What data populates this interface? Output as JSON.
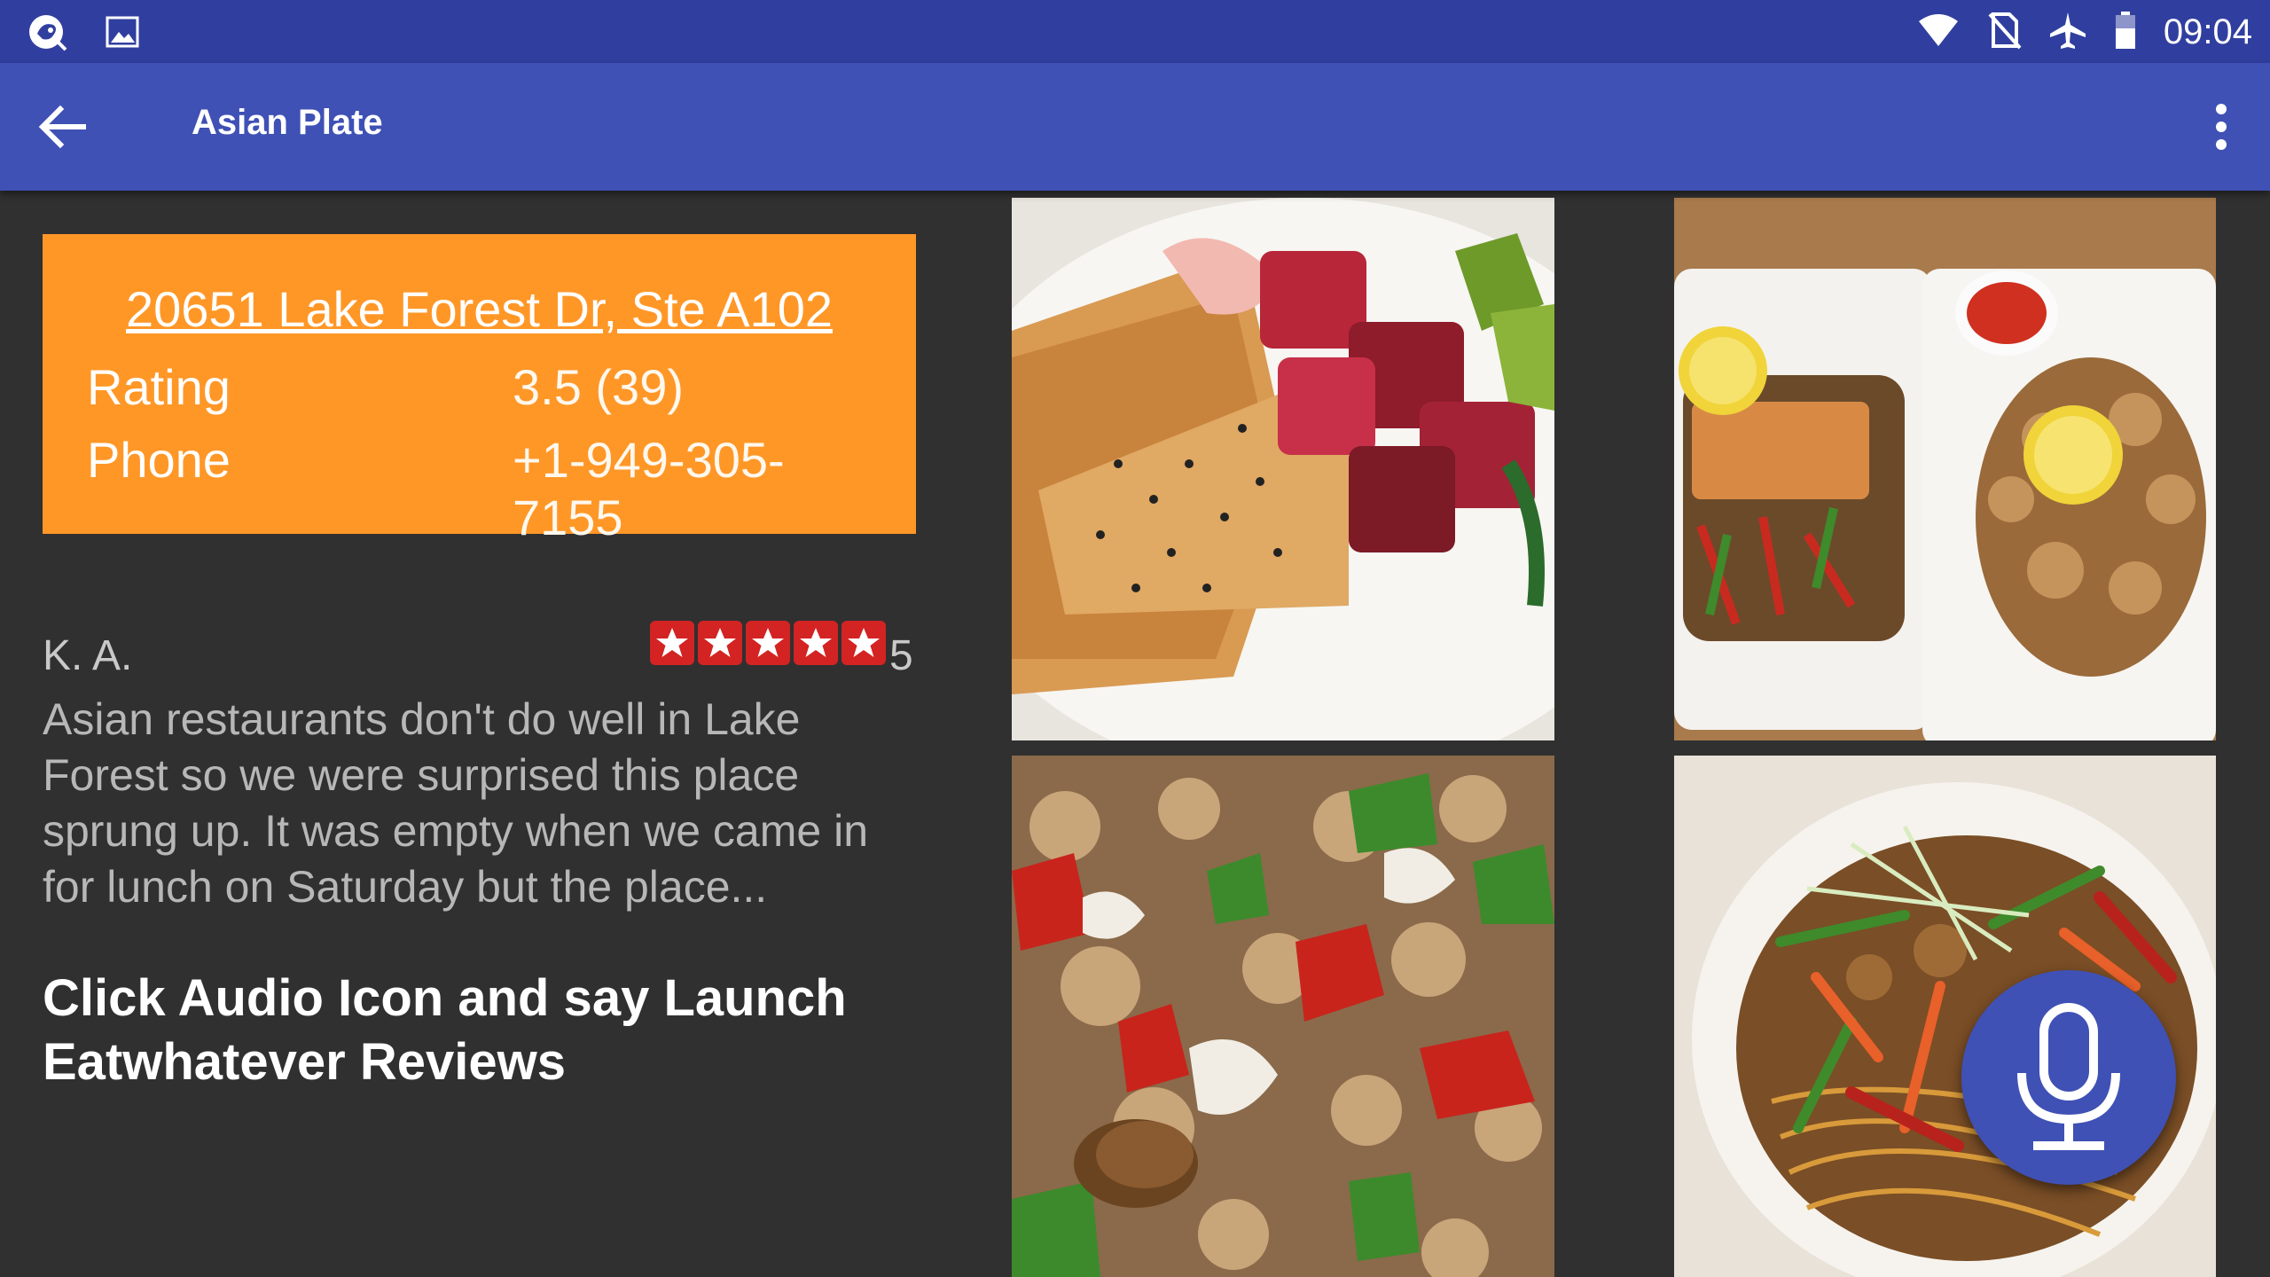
{
  "status_bar": {
    "time": "09:04",
    "left_icons": [
      "app-notification-icon",
      "image-icon"
    ],
    "right_icons": [
      "wifi-icon",
      "no-sim-icon",
      "airplane-mode-icon",
      "battery-icon"
    ]
  },
  "toolbar": {
    "title": "Asian Plate",
    "back_icon": "arrow-back-icon",
    "menu_icon": "more-vert-icon"
  },
  "info_card": {
    "address": "20651 Lake Forest Dr, Ste A102",
    "rating_label": "Rating",
    "rating_value": "3.5 (39)",
    "phone_label": "Phone",
    "phone_value": "+1-949-305-7155",
    "background_color": "#ff9727"
  },
  "review": {
    "author": "K. A.",
    "stars": 5,
    "stars_text": "5",
    "text": "Asian restaurants don't do well in Lake Forest so we were surprised this place sprung up. It was empty when we came in for lunch on Saturday but the place..."
  },
  "instruction": "Click Audio Icon and say Launch Eatwhatever Reviews",
  "photos": [
    {
      "subject": "ahi poke with wonton crisps"
    },
    {
      "subject": "salmon and calamari plates"
    },
    {
      "subject": "stir-fried chicken with vegetables and peanuts"
    },
    {
      "subject": "stir-fried noodles with vegetables"
    }
  ],
  "mic_button": {
    "icon": "microphone-icon"
  },
  "colors": {
    "status_bar": "#303f9f",
    "toolbar": "#3f51b5",
    "background": "#303030",
    "star_badge": "#d32323"
  }
}
